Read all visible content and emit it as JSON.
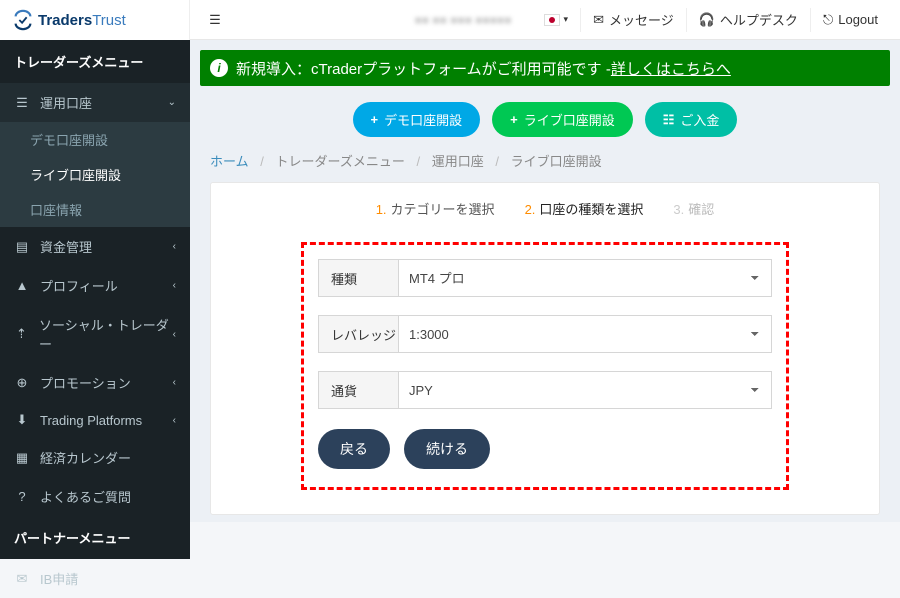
{
  "brand": {
    "part1": "Traders",
    "part2": "Trust"
  },
  "sidebar": {
    "header1": "トレーダーズメニュー",
    "unyou": "運用口座",
    "sub": {
      "demo": "デモ口座開設",
      "live": "ライブ口座開設",
      "info": "口座情報"
    },
    "shikin": "資金管理",
    "profile": "プロフィール",
    "social": "ソーシャル・トレーダー",
    "promo": "プロモーション",
    "platforms": "Trading Platforms",
    "calendar": "経済カレンダー",
    "faq": "よくあるご質問",
    "header2": "パートナーメニュー",
    "ib": "IB申請"
  },
  "topbar": {
    "messages": "メッセージ",
    "helpdesk": "ヘルプデスク",
    "logout": "Logout"
  },
  "announce": {
    "prefix": "新規導入：cTraderプラットフォームがご利用可能です - ",
    "link": "詳しくはこちらへ"
  },
  "actions": {
    "demo": "デモ口座開設",
    "live": "ライブ口座開設",
    "deposit": "ご入金"
  },
  "breadcrumb": {
    "home": "ホーム",
    "menu": "トレーダーズメニュー",
    "account": "運用口座",
    "current": "ライブ口座開設"
  },
  "steps": {
    "s1_num": "1.",
    "s1": "カテゴリーを選択",
    "s2_num": "2.",
    "s2": "口座の種類を選択",
    "s3_num": "3.",
    "s3": "確認"
  },
  "form": {
    "type_label": "種類",
    "type_value": "MT4 プロ",
    "leverage_label": "レバレッジ",
    "leverage_value": "1:3000",
    "currency_label": "通貨",
    "currency_value": "JPY",
    "back": "戻る",
    "continue": "続ける"
  }
}
